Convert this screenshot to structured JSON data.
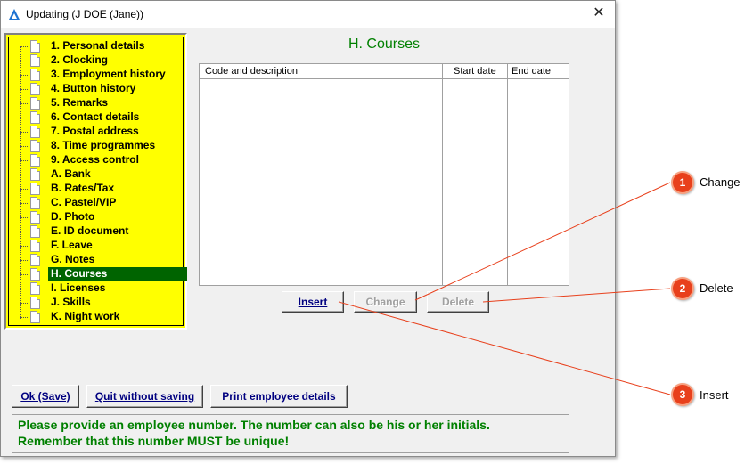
{
  "window": {
    "title": "Updating  (J DOE (Jane))",
    "close_glyph": "✕"
  },
  "tree": {
    "items": [
      {
        "label": "1. Personal details"
      },
      {
        "label": "2. Clocking"
      },
      {
        "label": "3. Employment history"
      },
      {
        "label": "4. Button history"
      },
      {
        "label": "5. Remarks"
      },
      {
        "label": "6. Contact details"
      },
      {
        "label": "7. Postal address"
      },
      {
        "label": "8. Time programmes"
      },
      {
        "label": "9. Access control"
      },
      {
        "label": "A. Bank"
      },
      {
        "label": "B. Rates/Tax"
      },
      {
        "label": "C. Pastel/VIP"
      },
      {
        "label": "D. Photo"
      },
      {
        "label": "E. ID document"
      },
      {
        "label": "F. Leave"
      },
      {
        "label": "G. Notes"
      },
      {
        "label": "H. Courses",
        "selected": true
      },
      {
        "label": "I. Licenses"
      },
      {
        "label": "J. Skills"
      },
      {
        "label": "K. Night work"
      }
    ]
  },
  "main": {
    "heading": "H. Courses",
    "table": {
      "columns": [
        "Code and description",
        "Start date",
        "End date"
      ]
    },
    "buttons": {
      "insert": "Insert",
      "change": "Change",
      "delete": "Delete"
    }
  },
  "footer": {
    "ok": "Ok (Save)",
    "quit": "Quit without saving",
    "print": "Print employee details",
    "message_line1": "Please provide an employee number. The number can also be his or her initials.",
    "message_line2": "Remember that this number MUST be unique!"
  },
  "callouts": [
    {
      "number": "1",
      "label": "Change"
    },
    {
      "number": "2",
      "label": "Delete"
    },
    {
      "number": "3",
      "label": "Insert"
    }
  ],
  "colors": {
    "tree_bg": "#ffff00",
    "selected_bg": "#006400",
    "heading": "#008000",
    "button_text": "#000080",
    "callout": "#e8401c"
  }
}
